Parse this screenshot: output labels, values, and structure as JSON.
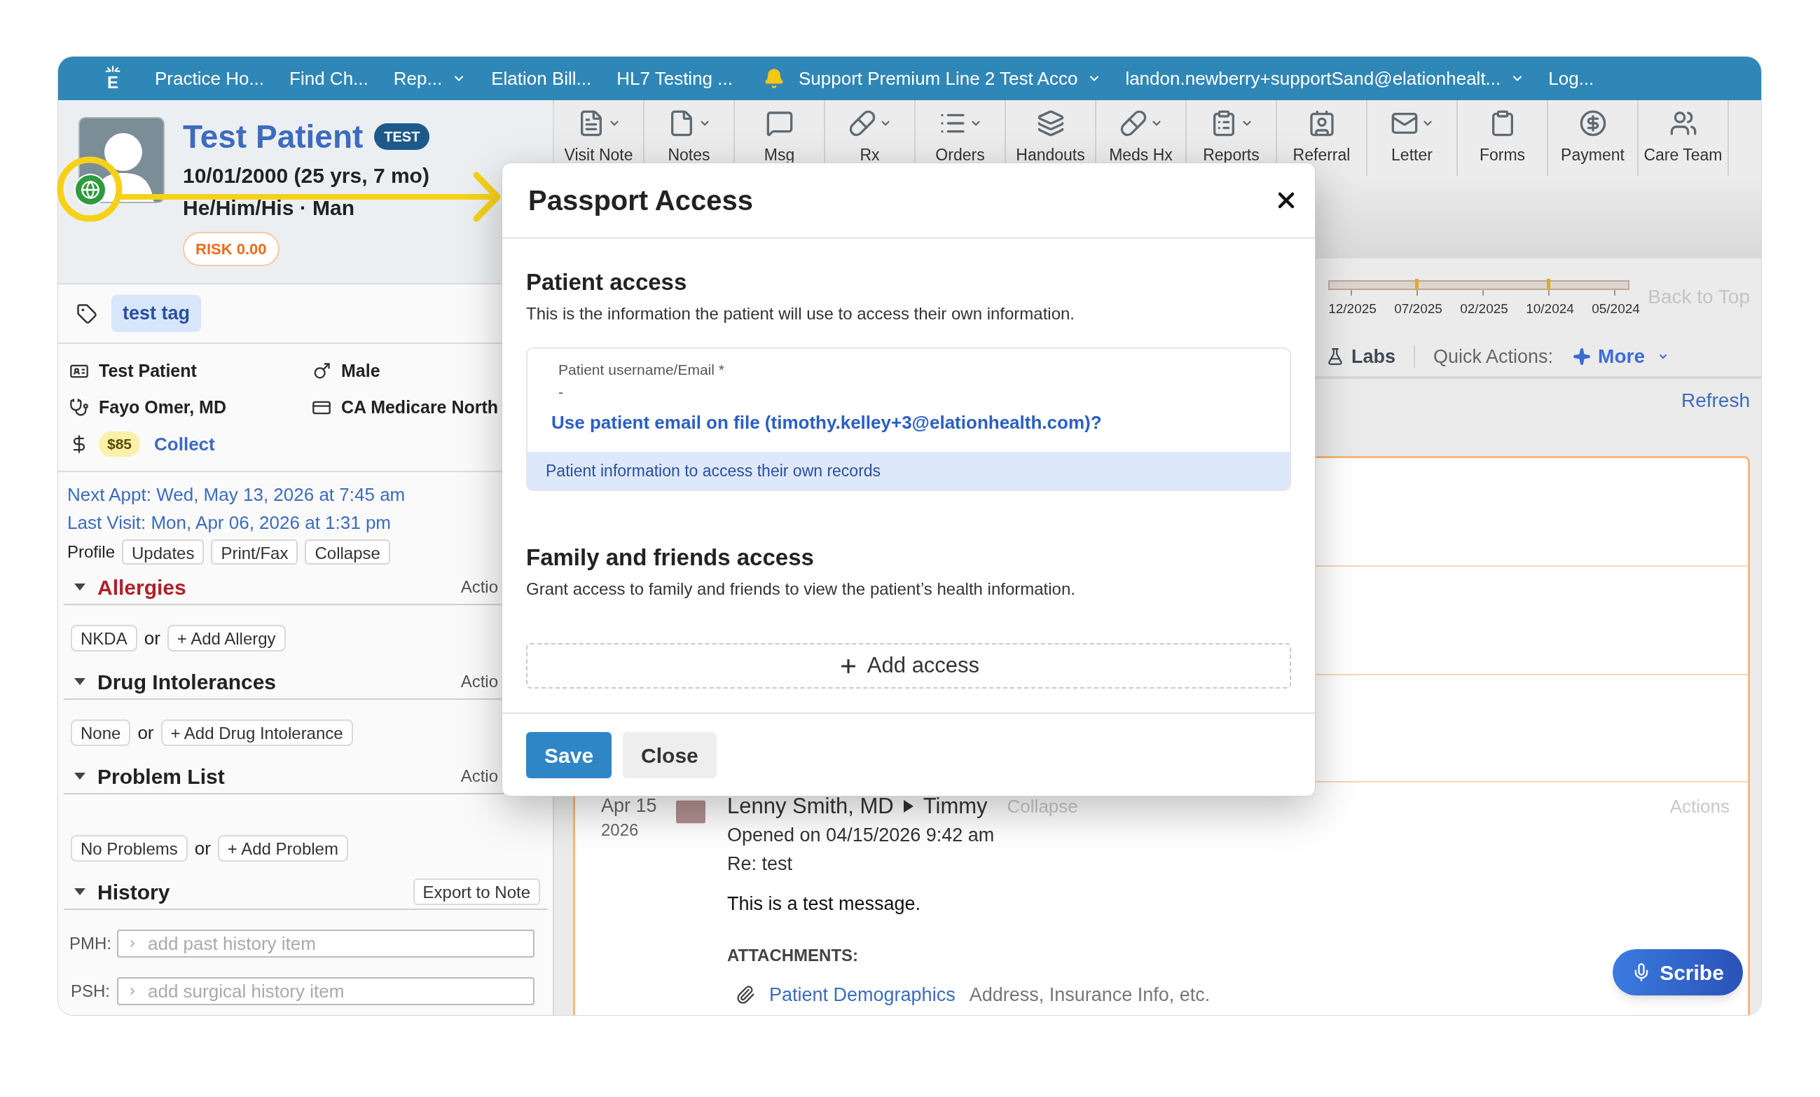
{
  "top_bar": {
    "logo": "E",
    "left_items": [
      {
        "label": "Practice Ho...",
        "dropdown": false
      },
      {
        "label": "Find Ch...",
        "dropdown": false
      },
      {
        "label": "Rep...",
        "dropdown": true
      },
      {
        "label": "Elation Bill...",
        "dropdown": false
      },
      {
        "label": "HL7 Testing ...",
        "dropdown": false
      }
    ],
    "right_items": [
      {
        "label": "Support Premium Line 2 Test Acco",
        "dropdown": true
      },
      {
        "label": "landon.newberry+supportSand@elationhealt...",
        "dropdown": true
      },
      {
        "label": "Log...",
        "dropdown": false
      }
    ]
  },
  "patient": {
    "name": "Test Patient",
    "badge": "TEST",
    "dob": "10/01/2000 (25 yrs, 7 mo)",
    "pronouns": "He/Him/His · Man",
    "risk": "RISK 0.00",
    "tags": [
      "test tag"
    ],
    "info": [
      {
        "kind": "name",
        "text": "Test Patient"
      },
      {
        "kind": "sex",
        "text": "Male"
      },
      {
        "kind": "provider",
        "text": "Fayo Omer, MD"
      },
      {
        "kind": "insurance",
        "text": "CA Medicare North"
      }
    ],
    "balance": {
      "amount": "$85",
      "action": "Collect"
    },
    "next_appt": "Next Appt: Wed, May 13, 2026 at 7:45 am",
    "last_visit": "Last Visit: Mon, Apr 06, 2026 at 1:31 pm",
    "profile_bar": {
      "label": "Profile",
      "buttons": [
        "Updates",
        "Print/Fax",
        "Collapse"
      ]
    }
  },
  "sections": [
    {
      "title": "Allergies",
      "alert": true,
      "expanded": true,
      "action": "Actio",
      "options": [
        "NKDA"
      ],
      "or": "or",
      "add": "+ Add Allergy"
    },
    {
      "title": "Drug Intolerances",
      "alert": false,
      "expanded": true,
      "action": "Actio",
      "options": [
        "None"
      ],
      "or": "or",
      "add": "+ Add Drug Intolerance"
    },
    {
      "title": "Problem List",
      "alert": false,
      "expanded": true,
      "action": "Actio",
      "options": [
        "No Problems"
      ],
      "or": "or",
      "add": "+ Add Problem"
    }
  ],
  "history": {
    "title": "History",
    "expanded": true,
    "button": "Export to Note",
    "fields": [
      {
        "label": "PMH:",
        "placeholder": "add past history item"
      },
      {
        "label": "PSH:",
        "placeholder": "add surgical history item"
      }
    ]
  },
  "toolbar": [
    {
      "label": "Visit Note",
      "dropdown": true
    },
    {
      "label": "Notes",
      "dropdown": true
    },
    {
      "label": "Msg",
      "dropdown": false
    },
    {
      "label": "Rx",
      "dropdown": true
    },
    {
      "label": "Orders",
      "dropdown": true
    },
    {
      "label": "Handouts",
      "dropdown": false
    },
    {
      "label": "Meds Hx",
      "dropdown": true
    },
    {
      "label": "Reports",
      "dropdown": true
    },
    {
      "label": "Referral",
      "dropdown": false
    },
    {
      "label": "Letter",
      "dropdown": true
    },
    {
      "label": "Forms",
      "dropdown": false
    },
    {
      "label": "Payment",
      "dropdown": false
    },
    {
      "label": "Care Team",
      "dropdown": false
    }
  ],
  "timeline": {
    "labels": [
      "12/2025",
      "07/2025",
      "02/2025",
      "10/2024",
      "05/2024"
    ],
    "back_to_top": "Back to Top"
  },
  "quick_bar": {
    "labs": "Labs",
    "label": "Quick Actions:",
    "more": "More"
  },
  "refresh": "Refresh",
  "message": {
    "date": "Apr 15",
    "year": "2026",
    "from": "Lenny Smith, MD",
    "to": "Timmy",
    "collapse": "Collapse",
    "actions": "Actions",
    "opened": "Opened on 04/15/2026 9:42 am",
    "subject": "Re: test",
    "body": "This is a test message.",
    "attachments_label": "ATTACHMENTS:",
    "attachments": [
      {
        "name": "Patient Demographics",
        "description": "Address, Insurance Info, etc."
      }
    ]
  },
  "scribe": "Scribe",
  "modal": {
    "title": "Passport Access",
    "patient_access": {
      "heading": "Patient access",
      "description": "This is the information the patient will use to access their own information.",
      "field": {
        "label": "Patient username/Email *",
        "value": "-"
      },
      "suggestion": "Use patient email on file (timothy.kelley+3@elationhealth.com)?",
      "hint": "Patient information to access their own records"
    },
    "family_access": {
      "heading": "Family and friends access",
      "description": "Grant access to family and friends to view the patient’s health information.",
      "add": "Add access"
    },
    "buttons": [
      {
        "label": "Save",
        "primary": true
      },
      {
        "label": "Close",
        "primary": false
      }
    ]
  }
}
